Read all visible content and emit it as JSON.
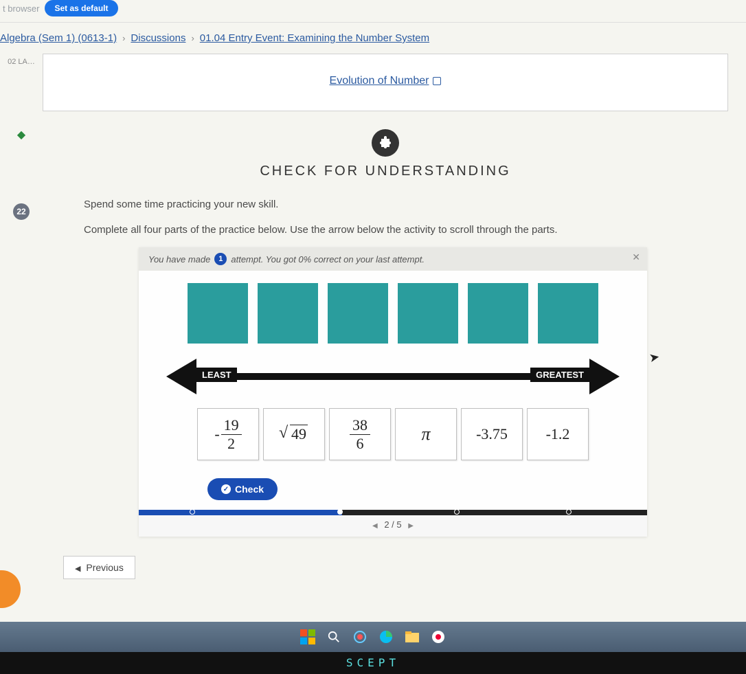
{
  "top": {
    "browser_label": "t browser",
    "default_btn": "Set as default"
  },
  "breadcrumb": {
    "course": "Algebra (Sem 1) (0613-1)",
    "section": "Discussions",
    "page": "01.04 Entry Event: Examining the Number System"
  },
  "left": {
    "code": "02 LA…",
    "badge": "22"
  },
  "resource": {
    "link": "Evolution of Number"
  },
  "section": {
    "title": "CHECK FOR UNDERSTANDING",
    "instr1": "Spend some time practicing your new skill.",
    "instr2": "Complete all four parts of the practice below. Use the arrow below the activity to scroll through the parts."
  },
  "activity": {
    "attempt_prefix": "You have made",
    "attempt_count": "1",
    "attempt_suffix": "attempt.  You got 0% correct on your last attempt.",
    "least": "LEAST",
    "greatest": "GREATEST",
    "tiles": {
      "t1_num": "19",
      "t1_den": "2",
      "t2_rad": "49",
      "t3_num": "38",
      "t3_den": "6",
      "t4": "π",
      "t5": "-3.75",
      "t6": "-1.2"
    },
    "check": "Check",
    "pager": "2 / 5"
  },
  "nav": {
    "previous": "Previous"
  },
  "bezel": "SCEPT"
}
